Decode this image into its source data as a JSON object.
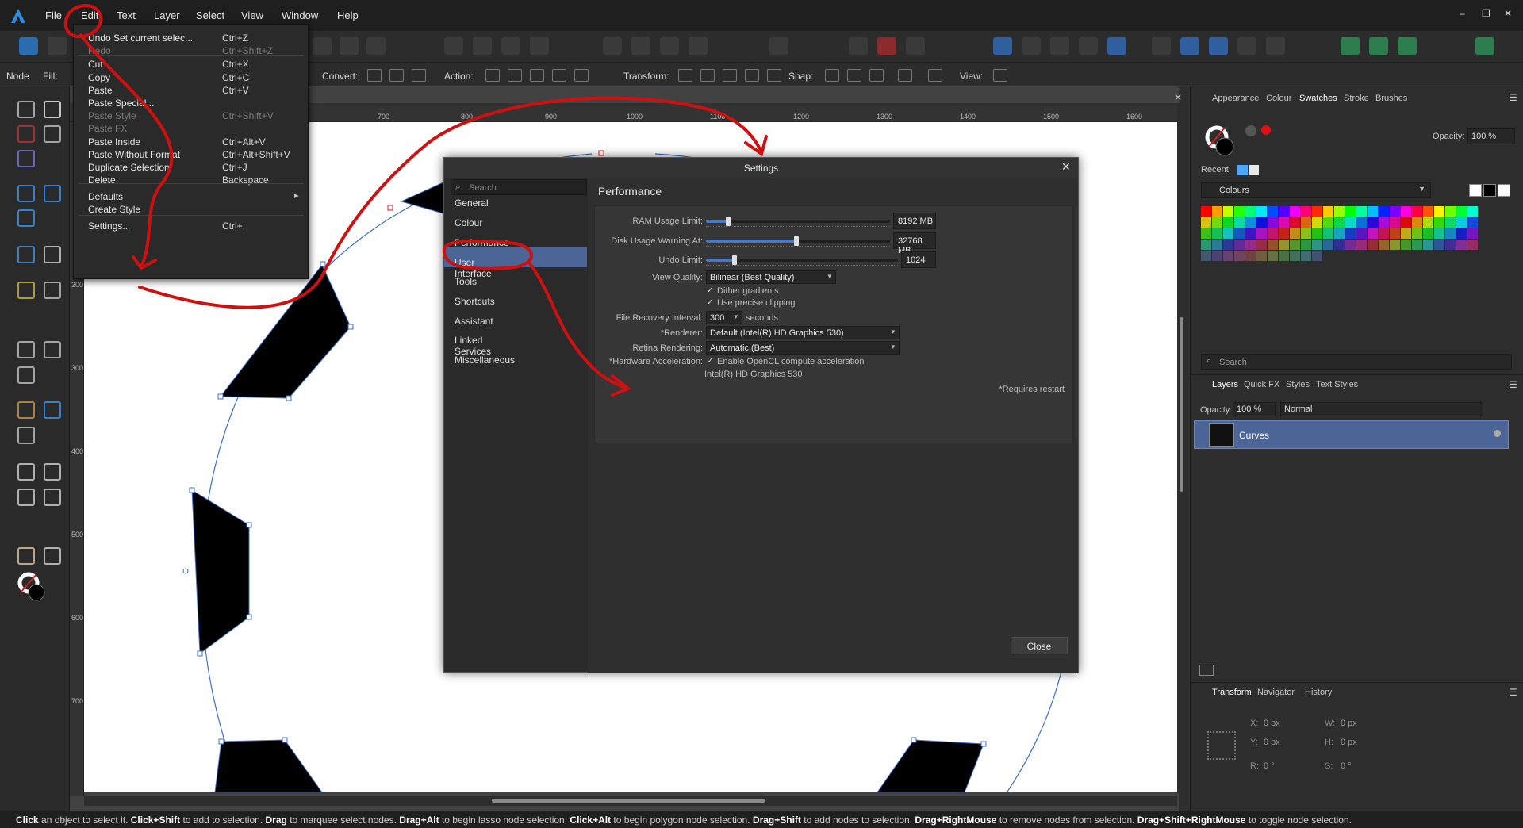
{
  "menubar": {
    "items": [
      "File",
      "Edit",
      "Text",
      "Layer",
      "Select",
      "View",
      "Window",
      "Help"
    ],
    "window_controls": [
      "–",
      "❐",
      "✕"
    ]
  },
  "toolbar2": {
    "persona": "Node",
    "fill_label": "Fill:",
    "convert_label": "Convert:",
    "action_label": "Action:",
    "transform_label": "Transform:",
    "snap_label": "Snap:",
    "view_label": "View:"
  },
  "edit_menu": {
    "items": [
      {
        "label": "Undo Set current selec...",
        "shortcut": "Ctrl+Z",
        "disabled": false
      },
      {
        "label": "Redo",
        "shortcut": "Ctrl+Shift+Z",
        "disabled": true
      },
      {
        "label": "Cut",
        "shortcut": "Ctrl+X",
        "disabled": false
      },
      {
        "label": "Copy",
        "shortcut": "Ctrl+C",
        "disabled": false
      },
      {
        "label": "Paste",
        "shortcut": "Ctrl+V",
        "disabled": false
      },
      {
        "label": "Paste Special...",
        "shortcut": "",
        "disabled": false
      },
      {
        "label": "Paste Style",
        "shortcut": "Ctrl+Shift+V",
        "disabled": true
      },
      {
        "label": "Paste FX",
        "shortcut": "",
        "disabled": true
      },
      {
        "label": "Paste Inside",
        "shortcut": "Ctrl+Alt+V",
        "disabled": false
      },
      {
        "label": "Paste Without Format",
        "shortcut": "Ctrl+Alt+Shift+V",
        "disabled": false
      },
      {
        "label": "Duplicate Selection",
        "shortcut": "Ctrl+J",
        "disabled": false
      },
      {
        "label": "Delete",
        "shortcut": "Backspace",
        "disabled": false
      },
      {
        "label": "Defaults",
        "shortcut": "",
        "disabled": false
      },
      {
        "label": "Create Style",
        "shortcut": "",
        "disabled": false
      },
      {
        "label": "Settings...",
        "shortcut": "Ctrl+,",
        "disabled": false
      }
    ]
  },
  "ruler": {
    "top_ticks": [
      "700",
      "800",
      "900",
      "1000",
      "1100",
      "1200",
      "1300",
      "1400",
      "1500",
      "1600"
    ],
    "left_ticks": [
      "200",
      "300",
      "400",
      "500",
      "600",
      "700"
    ]
  },
  "settings": {
    "title": "Settings",
    "search_placeholder": "Search",
    "nav": [
      "General",
      "Colour",
      "Performance",
      "User Interface",
      "Tools",
      "Shortcuts",
      "Assistant",
      "Linked Services",
      "Miscellaneous"
    ],
    "selected_nav": "Performance",
    "section_title": "Performance",
    "ram_label": "RAM Usage Limit:",
    "ram_value": "8192 MB",
    "ram_fraction": 0.12,
    "disk_label": "Disk Usage Warning At:",
    "disk_value": "32768 MB",
    "disk_fraction": 0.49,
    "undo_label": "Undo Limit:",
    "undo_value": "1024",
    "undo_fraction": 0.15,
    "view_quality_label": "View Quality:",
    "view_quality_value": "Bilinear (Best Quality)",
    "dither_label": "Dither gradients",
    "clipping_label": "Use precise clipping",
    "recovery_label": "File Recovery Interval:",
    "recovery_value": "300",
    "recovery_unit": "seconds",
    "renderer_label": "*Renderer:",
    "renderer_value": "Default (Intel(R) HD Graphics 530)",
    "retina_label": "Retina Rendering:",
    "retina_value": "Automatic (Best)",
    "hw_label": "*Hardware Acceleration:",
    "opencl_label": "Enable OpenCL compute acceleration",
    "gpu_name": "Intel(R) HD Graphics 530",
    "restart_note": "*Requires restart",
    "close_button": "Close"
  },
  "right_panel": {
    "top_tabs": [
      "Appearance",
      "Colour",
      "Swatches",
      "Stroke",
      "Brushes"
    ],
    "selected_top_tab": "Swatches",
    "opacity_label": "Opacity:",
    "opacity_value": "100 %",
    "recent_label": "Recent:",
    "palette_name": "Colours",
    "search_placeholder": "Search",
    "layer_tabs": [
      "Layers",
      "Quick FX",
      "Styles",
      "Text Styles"
    ],
    "selected_layer_tab": "Layers",
    "layers_opacity_label": "Opacity:",
    "layers_opacity_value": "100 %",
    "blend_mode": "Normal",
    "layer_name": "Curves",
    "bottom_tabs": [
      "Transform",
      "Navigator",
      "History"
    ],
    "selected_bottom_tab": "Transform",
    "transform": {
      "x_label": "X:",
      "x_value": "0 px",
      "y_label": "Y:",
      "y_value": "0 px",
      "w_label": "W:",
      "w_value": "0 px",
      "h_label": "H:",
      "h_value": "0 px",
      "r_label": "R:",
      "r_value": "0 °",
      "s_label": "S:",
      "s_value": "0 °"
    }
  },
  "status": {
    "parts": [
      {
        "b": "Click",
        "t": " an object to select it. "
      },
      {
        "b": "Click+Shift",
        "t": " to add to selection. "
      },
      {
        "b": "Drag",
        "t": " to marquee select nodes. "
      },
      {
        "b": "Drag+Alt",
        "t": " to begin lasso node selection. "
      },
      {
        "b": "Click+Alt",
        "t": " to begin polygon node selection. "
      },
      {
        "b": "Drag+Shift",
        "t": " to add nodes to selection. "
      },
      {
        "b": "Drag+RightMouse",
        "t": " to remove nodes from selection. "
      },
      {
        "b": "Drag+Shift+RightMouse",
        "t": " to toggle node selection."
      }
    ]
  },
  "colors": {
    "accent": "#4b6597",
    "annotation": "#d01010",
    "menu_bg": "#1f1f1f",
    "panel_bg": "#2d2d2d"
  }
}
